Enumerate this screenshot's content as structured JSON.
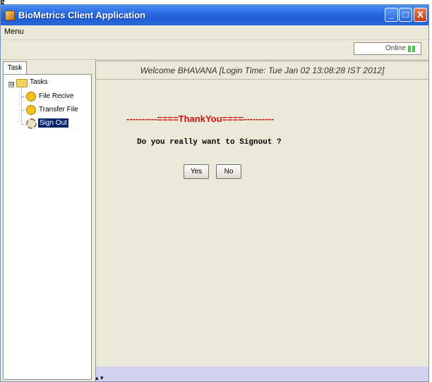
{
  "caption_cut": "g",
  "window": {
    "title": "BioMetrics Client Application",
    "controls": {
      "minimize": "_",
      "maximize": "□",
      "close": "X"
    }
  },
  "menu": {
    "label": "Menu"
  },
  "status": {
    "label": "Online",
    "color": "#46c74a"
  },
  "left_panel": {
    "tab_label": "Task",
    "tree": {
      "expander": "⊟",
      "root_label": "Tasks",
      "items": [
        {
          "label": "File Recive",
          "icon": "smiley-icon"
        },
        {
          "label": "Transfer File",
          "icon": "smiley-icon"
        },
        {
          "label": "Sign Out",
          "icon": "gear-icon",
          "selected": true
        }
      ]
    }
  },
  "main": {
    "welcome": "Welcome BHAVANA [Login Time: Tue Jan 02 13:08:28 IST 2012]",
    "thankyou": "----------====ThankYou====----------",
    "question": "Do you really want to Signout ?",
    "yes_label": "Yes",
    "no_label": "No"
  },
  "bottom_mark": "▴ ▾",
  "colors": {
    "title_bar": "#2a6ae0",
    "background": "#ece9d8",
    "thankyou": "#cc1111",
    "selection": "#0a246a"
  }
}
